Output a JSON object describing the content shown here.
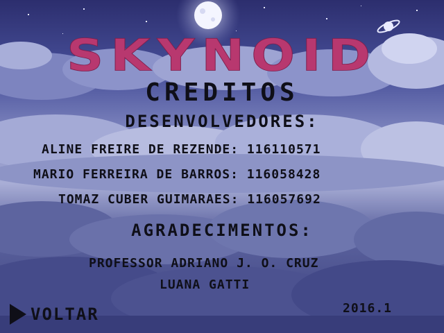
{
  "game": {
    "logo": "SKYNOID"
  },
  "credits": {
    "title": "CREDITOS",
    "developers_heading": "DESENVOLVEDORES:",
    "developers": [
      {
        "line": "ALINE FREIRE DE REZENDE: 116110571"
      },
      {
        "line": "MARIO FERREIRA DE BARROS: 116058428"
      },
      {
        "line": "TOMAZ CUBER GUIMARAES: 116057692"
      }
    ],
    "thanks_heading": "AGRADECIMENTOS:",
    "thanks": [
      {
        "line": "PROFESSOR ADRIANO J. O. CRUZ"
      },
      {
        "line": "LUANA GATTI"
      }
    ]
  },
  "menu": {
    "back_label": "VOLTAR"
  },
  "version": "2016.1",
  "colors": {
    "logo": "#b8386f",
    "text": "#0f0f18",
    "sky_dark": "#2c2e6e",
    "cloud_light": "#a9aed6"
  },
  "icons": {
    "back": "play-triangle-icon",
    "moon": "moon-icon",
    "planet": "ringed-planet-icon"
  }
}
